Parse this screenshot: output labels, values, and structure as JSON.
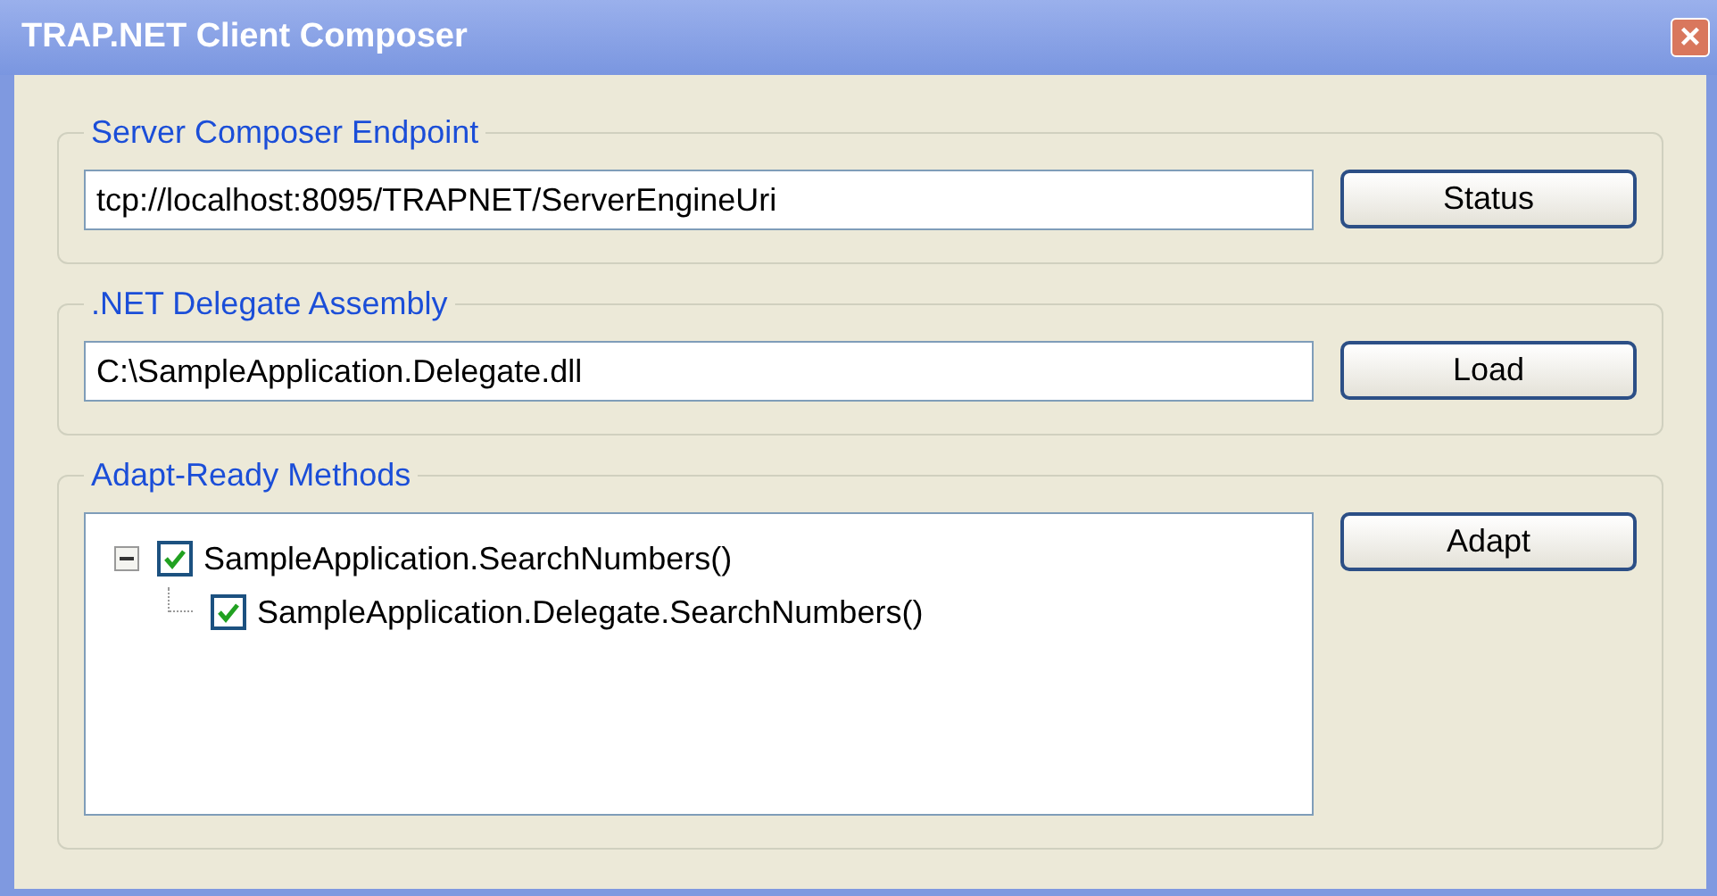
{
  "window": {
    "title": "TRAP.NET Client Composer",
    "close": "×"
  },
  "groups": [
    {
      "kind": "field",
      "title": "Server Composer Endpoint",
      "value": "tcp://localhost:8095/TRAPNET/ServerEngineUri",
      "button": "Status"
    },
    {
      "kind": "field",
      "title": ".NET Delegate Assembly",
      "value": "C:\\SampleApplication.Delegate.dll",
      "button": "Load"
    },
    {
      "kind": "tree",
      "title": "Adapt-Ready Methods",
      "button": "Adapt",
      "tree": [
        {
          "label": "SampleApplication.SearchNumbers()",
          "checked": true,
          "expanded": true,
          "children": [
            {
              "label": "SampleApplication.Delegate.SearchNumbers()",
              "checked": true
            }
          ]
        }
      ]
    }
  ]
}
